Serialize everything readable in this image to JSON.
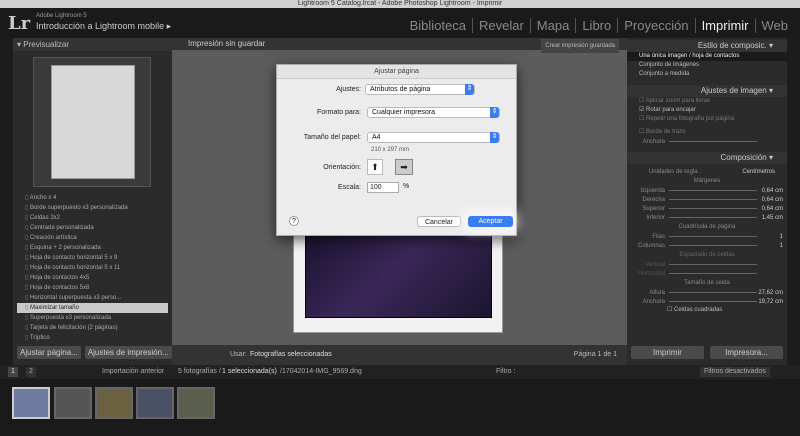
{
  "window_title": "Lightroom 5 Catalog.lrcat - Adobe Photoshop Lightroom - Imprimir",
  "brand": {
    "logo": "Lr",
    "product": "Adobe Lightroom 5",
    "sub": "Introducción a Lightroom mobile"
  },
  "modules": [
    "Biblioteca",
    "Revelar",
    "Mapa",
    "Libro",
    "Proyección",
    "Imprimir",
    "Web"
  ],
  "left": {
    "preview_header": "Previsualizar",
    "templates": [
      "Ancho x 4",
      "Borde superpuesto x3 personalizada",
      "Celdas 2x2",
      "Centrada personalizada",
      "Creación artística",
      "Esquina + 2 personalizada",
      "Hoja de contacto horizontal 5 x 9",
      "Hoja de contacto horizontal 5 x 11",
      "Hoja de contactos 4x5",
      "Hoja de contactos 5x8",
      "Horizontal superpuesta x3 perso...",
      "Maximizar tamaño",
      "Superpuesta x3 personalizada",
      "Tarjeta de felicitación (2 páginas)",
      "Tríptico"
    ],
    "btn_page_setup": "Ajustar página...",
    "btn_print_setup": "Ajustes de impresión..."
  },
  "center": {
    "title": "Impresión sin guardar",
    "save_btn": "Crear impresión guardada",
    "use_label": "Usar:",
    "use_value": "Fotografías seleccionadas",
    "page_info": "Página 1 de 1"
  },
  "right": {
    "layout_style": "Estilo de composic.",
    "layout_options": [
      "Una única imagen / hoja de contactos",
      "Conjunto de imágenes",
      "Conjunto a medida"
    ],
    "image_settings": "Ajustes de imagen",
    "image_opts": [
      "Aplicar zoom para llenar",
      "Rotar para encajar",
      "Repetir una fotografía por página"
    ],
    "stroke_border": "Borde de trazo",
    "stroke_width": "Anchura",
    "composition": "Composición",
    "ruler_units": "Unidades de regla :",
    "ruler_value": "Centímetros",
    "margins": "Márgenes",
    "margin_rows": [
      {
        "label": "Izquierda",
        "value": "0,64 cm"
      },
      {
        "label": "Derecha",
        "value": "0,64 cm"
      },
      {
        "label": "Superior",
        "value": "0,64 cm"
      },
      {
        "label": "Inferior",
        "value": "1,45 cm"
      }
    ],
    "grid": "Cuadrícula de página",
    "grid_rows": [
      {
        "label": "Filas",
        "value": "1"
      },
      {
        "label": "Columnas",
        "value": "1"
      }
    ],
    "spacing": "Espaciado de celdas",
    "spacing_rows": [
      {
        "label": "Vertical",
        "value": ""
      },
      {
        "label": "Horizontal",
        "value": ""
      }
    ],
    "cell_size": "Tamaño de celda",
    "cell_rows": [
      {
        "label": "Altura",
        "value": "27,62 cm"
      },
      {
        "label": "Anchura",
        "value": "19,72 cm"
      }
    ],
    "square_cells": "Celdas cuadradas",
    "print_btn": "Imprimir",
    "printer_btn": "Impresora..."
  },
  "filmstrip": {
    "source": "Importación anterior",
    "info_prefix": "5 fotografías /",
    "info_sel": "1 seleccionada(s)",
    "info_file": "/17042014-IMG_9569.dng",
    "filter_label": "Filtro :",
    "filter_value": "Filtros desactivados",
    "pages": [
      "1",
      "2"
    ]
  },
  "dialog": {
    "title": "Ajustar página",
    "settings_label": "Ajustes:",
    "settings_value": "Atributos de página",
    "format_label": "Formato para:",
    "format_value": "Cualquier impresora",
    "paper_label": "Tamaño del papel:",
    "paper_value": "A4",
    "paper_dims": "210 x 297 mm",
    "orientation_label": "Orientación:",
    "scale_label": "Escala:",
    "scale_value": "100",
    "scale_unit": "%",
    "help": "?",
    "cancel": "Cancelar",
    "ok": "Aceptar"
  }
}
